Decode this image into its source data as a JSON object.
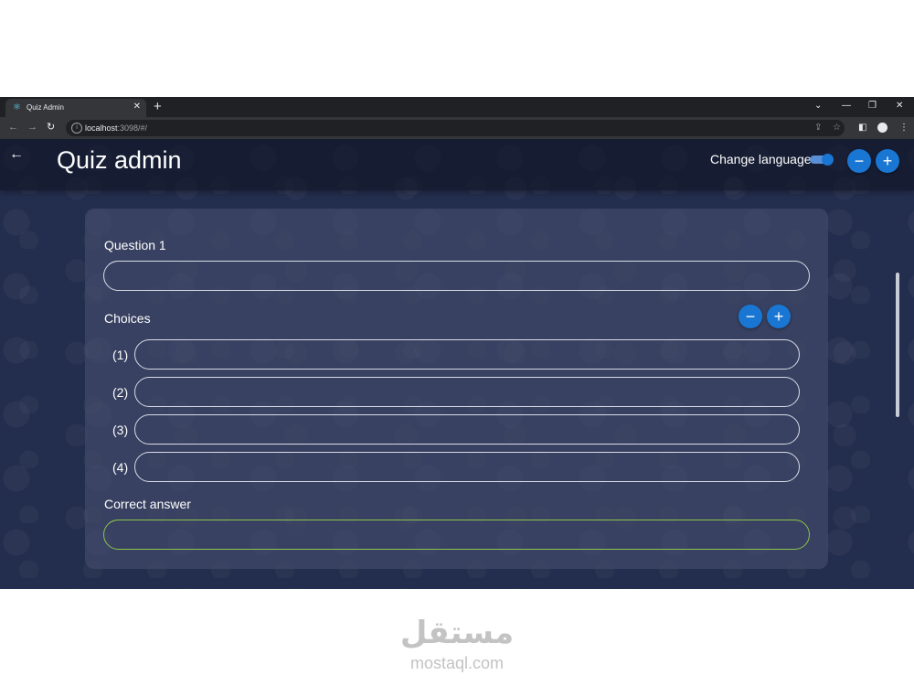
{
  "browser": {
    "tab_title": "Quiz Admin",
    "tab_close": "✕",
    "new_tab": "+",
    "url_host": "localhost",
    "url_rest": ":3098/#/",
    "controls": {
      "tab_search": "⌄",
      "minimize": "—",
      "restore": "❐",
      "close": "✕"
    },
    "nav": {
      "back": "←",
      "forward": "→",
      "reload": "↻"
    }
  },
  "app": {
    "title": "Quiz admin",
    "change_language_label": "Change language",
    "language_toggle_on": true,
    "remove_question": "−",
    "add_question": "+"
  },
  "form": {
    "question_label": "Question 1",
    "question_value": "",
    "choices_label": "Choices",
    "remove_choice": "−",
    "add_choice": "+",
    "choices": [
      {
        "number": "(1)",
        "value": ""
      },
      {
        "number": "(2)",
        "value": ""
      },
      {
        "number": "(3)",
        "value": ""
      },
      {
        "number": "(4)",
        "value": ""
      }
    ],
    "correct_answer_label": "Correct answer",
    "correct_answer_value": ""
  },
  "watermark": {
    "arabic": "مستقل",
    "latin": "mostaql.com"
  },
  "colors": {
    "accent": "#1976d2",
    "page_bg": "#232d4d",
    "correct_border": "#8bc34a"
  }
}
